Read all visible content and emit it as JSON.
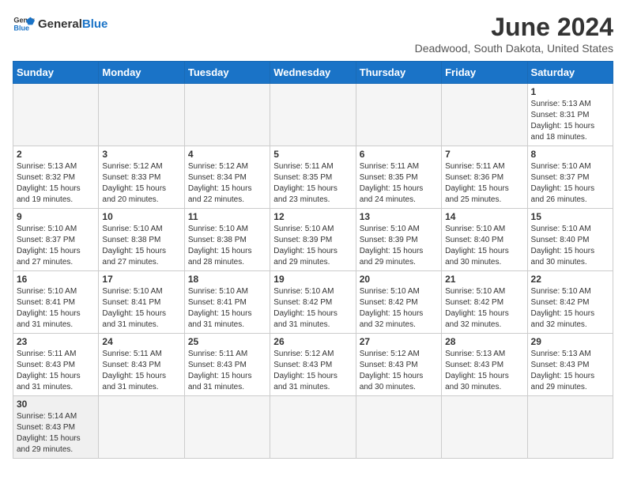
{
  "header": {
    "logo_general": "General",
    "logo_blue": "Blue",
    "month_title": "June 2024",
    "subtitle": "Deadwood, South Dakota, United States"
  },
  "days_of_week": [
    "Sunday",
    "Monday",
    "Tuesday",
    "Wednesday",
    "Thursday",
    "Friday",
    "Saturday"
  ],
  "weeks": [
    [
      {
        "day": "",
        "info": ""
      },
      {
        "day": "",
        "info": ""
      },
      {
        "day": "",
        "info": ""
      },
      {
        "day": "",
        "info": ""
      },
      {
        "day": "",
        "info": ""
      },
      {
        "day": "",
        "info": ""
      },
      {
        "day": "1",
        "info": "Sunrise: 5:13 AM\nSunset: 8:31 PM\nDaylight: 15 hours\nand 18 minutes."
      }
    ],
    [
      {
        "day": "2",
        "info": "Sunrise: 5:13 AM\nSunset: 8:32 PM\nDaylight: 15 hours\nand 19 minutes."
      },
      {
        "day": "3",
        "info": "Sunrise: 5:12 AM\nSunset: 8:33 PM\nDaylight: 15 hours\nand 20 minutes."
      },
      {
        "day": "4",
        "info": "Sunrise: 5:12 AM\nSunset: 8:34 PM\nDaylight: 15 hours\nand 22 minutes."
      },
      {
        "day": "5",
        "info": "Sunrise: 5:11 AM\nSunset: 8:35 PM\nDaylight: 15 hours\nand 23 minutes."
      },
      {
        "day": "6",
        "info": "Sunrise: 5:11 AM\nSunset: 8:35 PM\nDaylight: 15 hours\nand 24 minutes."
      },
      {
        "day": "7",
        "info": "Sunrise: 5:11 AM\nSunset: 8:36 PM\nDaylight: 15 hours\nand 25 minutes."
      },
      {
        "day": "8",
        "info": "Sunrise: 5:10 AM\nSunset: 8:37 PM\nDaylight: 15 hours\nand 26 minutes."
      }
    ],
    [
      {
        "day": "9",
        "info": "Sunrise: 5:10 AM\nSunset: 8:37 PM\nDaylight: 15 hours\nand 27 minutes."
      },
      {
        "day": "10",
        "info": "Sunrise: 5:10 AM\nSunset: 8:38 PM\nDaylight: 15 hours\nand 27 minutes."
      },
      {
        "day": "11",
        "info": "Sunrise: 5:10 AM\nSunset: 8:38 PM\nDaylight: 15 hours\nand 28 minutes."
      },
      {
        "day": "12",
        "info": "Sunrise: 5:10 AM\nSunset: 8:39 PM\nDaylight: 15 hours\nand 29 minutes."
      },
      {
        "day": "13",
        "info": "Sunrise: 5:10 AM\nSunset: 8:39 PM\nDaylight: 15 hours\nand 29 minutes."
      },
      {
        "day": "14",
        "info": "Sunrise: 5:10 AM\nSunset: 8:40 PM\nDaylight: 15 hours\nand 30 minutes."
      },
      {
        "day": "15",
        "info": "Sunrise: 5:10 AM\nSunset: 8:40 PM\nDaylight: 15 hours\nand 30 minutes."
      }
    ],
    [
      {
        "day": "16",
        "info": "Sunrise: 5:10 AM\nSunset: 8:41 PM\nDaylight: 15 hours\nand 31 minutes."
      },
      {
        "day": "17",
        "info": "Sunrise: 5:10 AM\nSunset: 8:41 PM\nDaylight: 15 hours\nand 31 minutes."
      },
      {
        "day": "18",
        "info": "Sunrise: 5:10 AM\nSunset: 8:41 PM\nDaylight: 15 hours\nand 31 minutes."
      },
      {
        "day": "19",
        "info": "Sunrise: 5:10 AM\nSunset: 8:42 PM\nDaylight: 15 hours\nand 31 minutes."
      },
      {
        "day": "20",
        "info": "Sunrise: 5:10 AM\nSunset: 8:42 PM\nDaylight: 15 hours\nand 32 minutes."
      },
      {
        "day": "21",
        "info": "Sunrise: 5:10 AM\nSunset: 8:42 PM\nDaylight: 15 hours\nand 32 minutes."
      },
      {
        "day": "22",
        "info": "Sunrise: 5:10 AM\nSunset: 8:42 PM\nDaylight: 15 hours\nand 32 minutes."
      }
    ],
    [
      {
        "day": "23",
        "info": "Sunrise: 5:11 AM\nSunset: 8:43 PM\nDaylight: 15 hours\nand 31 minutes."
      },
      {
        "day": "24",
        "info": "Sunrise: 5:11 AM\nSunset: 8:43 PM\nDaylight: 15 hours\nand 31 minutes."
      },
      {
        "day": "25",
        "info": "Sunrise: 5:11 AM\nSunset: 8:43 PM\nDaylight: 15 hours\nand 31 minutes."
      },
      {
        "day": "26",
        "info": "Sunrise: 5:12 AM\nSunset: 8:43 PM\nDaylight: 15 hours\nand 31 minutes."
      },
      {
        "day": "27",
        "info": "Sunrise: 5:12 AM\nSunset: 8:43 PM\nDaylight: 15 hours\nand 30 minutes."
      },
      {
        "day": "28",
        "info": "Sunrise: 5:13 AM\nSunset: 8:43 PM\nDaylight: 15 hours\nand 30 minutes."
      },
      {
        "day": "29",
        "info": "Sunrise: 5:13 AM\nSunset: 8:43 PM\nDaylight: 15 hours\nand 29 minutes."
      }
    ],
    [
      {
        "day": "30",
        "info": "Sunrise: 5:14 AM\nSunset: 8:43 PM\nDaylight: 15 hours\nand 29 minutes."
      },
      {
        "day": "",
        "info": ""
      },
      {
        "day": "",
        "info": ""
      },
      {
        "day": "",
        "info": ""
      },
      {
        "day": "",
        "info": ""
      },
      {
        "day": "",
        "info": ""
      },
      {
        "day": "",
        "info": ""
      }
    ]
  ]
}
